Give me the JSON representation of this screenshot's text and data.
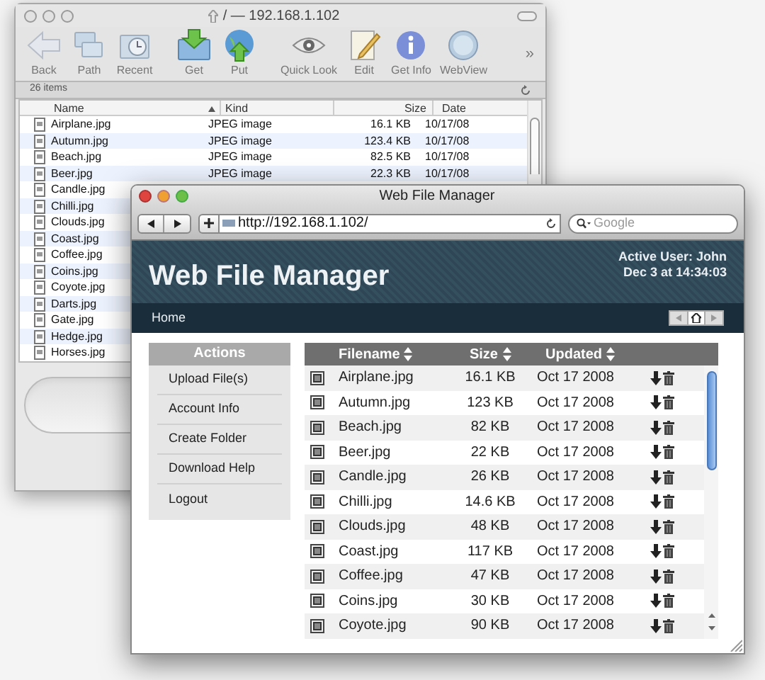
{
  "back_window": {
    "title": "/ — 192.168.1.102",
    "toolbar": [
      {
        "label": "Back",
        "kind": "back"
      },
      {
        "label": "Path",
        "kind": "path"
      },
      {
        "label": "Recent",
        "kind": "recent"
      },
      {
        "label": "Get",
        "kind": "get"
      },
      {
        "label": "Put",
        "kind": "put"
      },
      {
        "label": "Quick Look",
        "kind": "quicklook"
      },
      {
        "label": "Edit",
        "kind": "edit"
      },
      {
        "label": "Get Info",
        "kind": "info"
      },
      {
        "label": "WebView",
        "kind": "webview"
      }
    ],
    "overflow": "»",
    "status": "26 items",
    "columns": [
      "Name",
      "Kind",
      "Size",
      "Date"
    ],
    "rows": [
      {
        "name": "Airplane.jpg",
        "type": "JPEG image",
        "size": "16.1 KB",
        "date": "10/17/08"
      },
      {
        "name": "Autumn.jpg",
        "type": "JPEG image",
        "size": "123.4 KB",
        "date": "10/17/08"
      },
      {
        "name": "Beach.jpg",
        "type": "JPEG image",
        "size": "82.5 KB",
        "date": "10/17/08"
      },
      {
        "name": "Beer.jpg",
        "type": "JPEG image",
        "size": "22.3 KB",
        "date": "10/17/08"
      },
      {
        "name": "Candle.jpg"
      },
      {
        "name": "Chilli.jpg"
      },
      {
        "name": "Clouds.jpg"
      },
      {
        "name": "Coast.jpg"
      },
      {
        "name": "Coffee.jpg"
      },
      {
        "name": "Coins.jpg"
      },
      {
        "name": "Coyote.jpg"
      },
      {
        "name": "Darts.jpg"
      },
      {
        "name": "Gate.jpg"
      },
      {
        "name": "Hedge.jpg"
      },
      {
        "name": "Horses.jpg"
      }
    ]
  },
  "front_window": {
    "title": "Web File Manager",
    "url": "http://192.168.1.102/",
    "search": {
      "placeholder": "Google"
    },
    "header": {
      "title": "Web File Manager",
      "user": "Active User: John",
      "datetime": "Dec 3 at 14:34:03"
    },
    "nav": "Home",
    "sidebar": {
      "heading": "Actions",
      "items": [
        "Upload File(s)",
        "Account Info",
        "Create Folder",
        "Download Help",
        "Logout"
      ]
    },
    "table": {
      "columns": [
        "Filename",
        "Size",
        "Updated"
      ],
      "rows": [
        {
          "name": "Airplane.jpg",
          "size": "16.1 KB",
          "updated": "Oct 17 2008"
        },
        {
          "name": "Autumn.jpg",
          "size": "123 KB",
          "updated": "Oct 17 2008"
        },
        {
          "name": "Beach.jpg",
          "size": "82 KB",
          "updated": "Oct 17 2008"
        },
        {
          "name": "Beer.jpg",
          "size": "22 KB",
          "updated": "Oct 17 2008"
        },
        {
          "name": "Candle.jpg",
          "size": "26 KB",
          "updated": "Oct 17 2008"
        },
        {
          "name": "Chilli.jpg",
          "size": "14.6 KB",
          "updated": "Oct 17 2008"
        },
        {
          "name": "Clouds.jpg",
          "size": "48 KB",
          "updated": "Oct 17 2008"
        },
        {
          "name": "Coast.jpg",
          "size": "117 KB",
          "updated": "Oct 17 2008"
        },
        {
          "name": "Coffee.jpg",
          "size": "47 KB",
          "updated": "Oct 17 2008"
        },
        {
          "name": "Coins.jpg",
          "size": "30 KB",
          "updated": "Oct 17 2008"
        },
        {
          "name": "Coyote.jpg",
          "size": "90 KB",
          "updated": "Oct 17 2008"
        }
      ]
    }
  }
}
